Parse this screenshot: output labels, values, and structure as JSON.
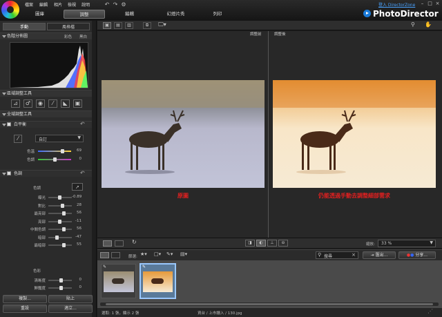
{
  "menu": [
    "檔案",
    "編輯",
    "相片",
    "檢視",
    "說明"
  ],
  "tabs": [
    "圖庫",
    "調整",
    "編輯",
    "幻燈片秀",
    "列印"
  ],
  "brand": "PhotoDirector",
  "signin": "登入 DirectorZone",
  "left_tabs": [
    "手動",
    "風格檔"
  ],
  "histogram": {
    "title": "色階分佈圖",
    "mode_color": "彩色",
    "mode_bw": "黑白"
  },
  "regional_tools": "區域調整工具",
  "global_tools": "全域調整工具",
  "white_balance": {
    "title": "白平衡",
    "preset": "自訂",
    "sliders": [
      {
        "label": "色溫",
        "value": "69"
      },
      {
        "label": "色調",
        "value": "0"
      }
    ]
  },
  "tone": {
    "title": "色調",
    "sub": "色調",
    "sliders": [
      {
        "label": "曝光",
        "value": "-0.89"
      },
      {
        "label": "對比",
        "value": "28"
      },
      {
        "label": "最亮部",
        "value": "56"
      },
      {
        "label": "亮部",
        "value": "-11"
      },
      {
        "label": "中間色調",
        "value": "56"
      },
      {
        "label": "暗部",
        "value": "-47"
      },
      {
        "label": "最暗部",
        "value": "55"
      }
    ]
  },
  "color": {
    "sub": "色彩",
    "sliders": [
      {
        "label": "清晰度",
        "value": "0"
      },
      {
        "label": "鮮豔度",
        "value": "0"
      }
    ]
  },
  "left_buttons": [
    "複製...",
    "貼上",
    "重設",
    "適立..."
  ],
  "view": {
    "before_label": "調整前",
    "after_label": "調整後",
    "left_caption": "原圖",
    "right_caption": "仍能透過手動去調整細部需求"
  },
  "zoom": {
    "label": "縮放:",
    "value": "33 %"
  },
  "filmbar": {
    "filter_label": "節選:",
    "search_placeholder": "搜尋",
    "export_label": "匯出...",
    "share_label": "分享..."
  },
  "status": {
    "left": "選取: 1 張，顯示 2 張",
    "right": "資台 / 上市讀入 / 130.jpg"
  }
}
